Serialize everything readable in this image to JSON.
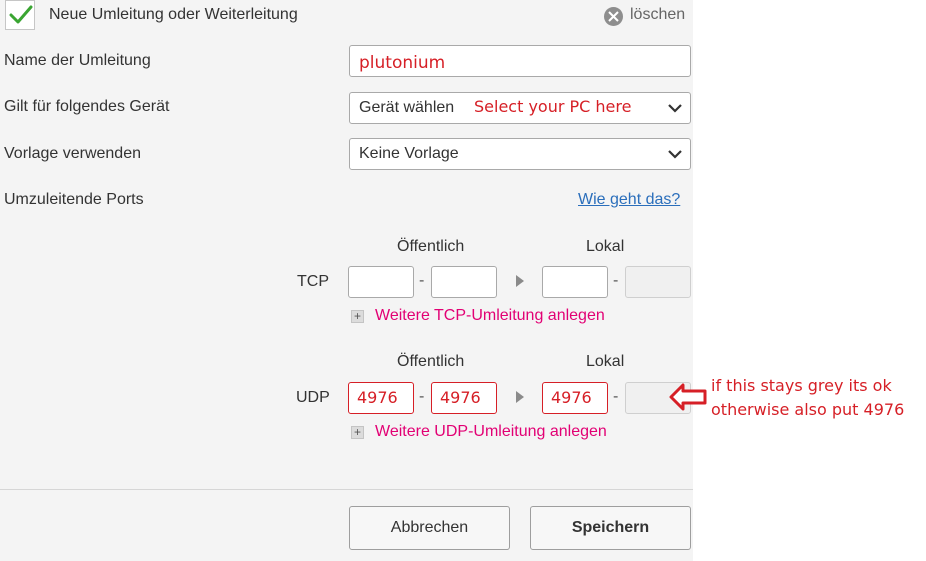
{
  "header": {
    "title": "Neue Umleitung oder Weiterleitung",
    "delete_label": "löschen"
  },
  "form": {
    "name_label": "Name der Umleitung",
    "name_value": "plutonium",
    "device_label": "Gilt für folgendes Gerät",
    "device_value": "Gerät wählen",
    "template_label": "Vorlage verwenden",
    "template_value": "Keine Vorlage",
    "ports_label": "Umzuleitende Ports",
    "help_link": "Wie geht das?"
  },
  "ports": {
    "public_header": "Öffentlich",
    "local_header": "Lokal",
    "dash": "-",
    "tcp": {
      "label": "TCP",
      "public_from": "",
      "public_to": "",
      "local_from": "",
      "local_to": "",
      "add_label": "Weitere TCP-Umleitung anlegen"
    },
    "udp": {
      "label": "UDP",
      "public_from": "4976",
      "public_to": "4976",
      "local_from": "4976",
      "local_to": "",
      "add_label": "Weitere UDP-Umleitung anlegen"
    }
  },
  "buttons": {
    "cancel": "Abbrechen",
    "save": "Speichern"
  },
  "annotations": {
    "device_hint": "Select your PC here",
    "udp_note_line1": "if this stays grey its ok",
    "udp_note_line2": "otherwise also put 4976"
  },
  "colors": {
    "annotation_red": "#d61f26",
    "link_magenta": "#e20074",
    "check_green": "#3aa532",
    "help_link_blue": "#2a6ebb"
  }
}
